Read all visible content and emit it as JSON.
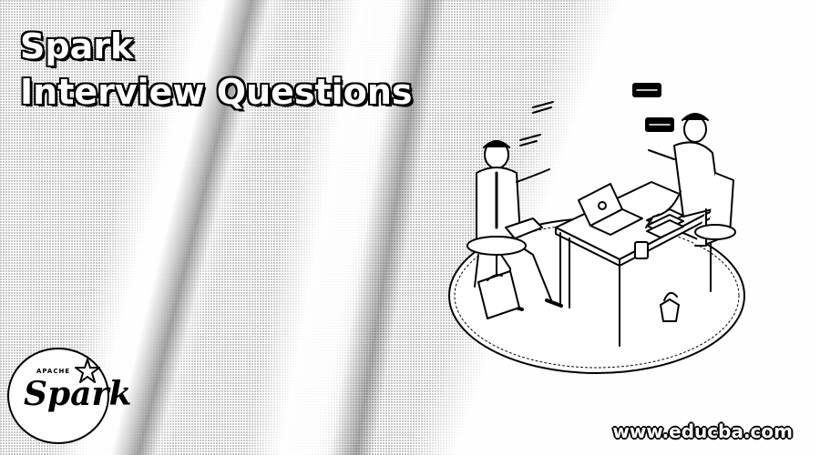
{
  "title": {
    "line1": "Spark",
    "line2": "Interview Questions"
  },
  "logo": {
    "apache": "APACHE",
    "name": "Spark",
    "icon": "spark-star-icon"
  },
  "footer": {
    "url": "www.educba.com"
  },
  "colors": {
    "ink": "#000000",
    "paper": "#ffffff"
  },
  "illustration": {
    "icon": "interview-scene-illustration"
  }
}
